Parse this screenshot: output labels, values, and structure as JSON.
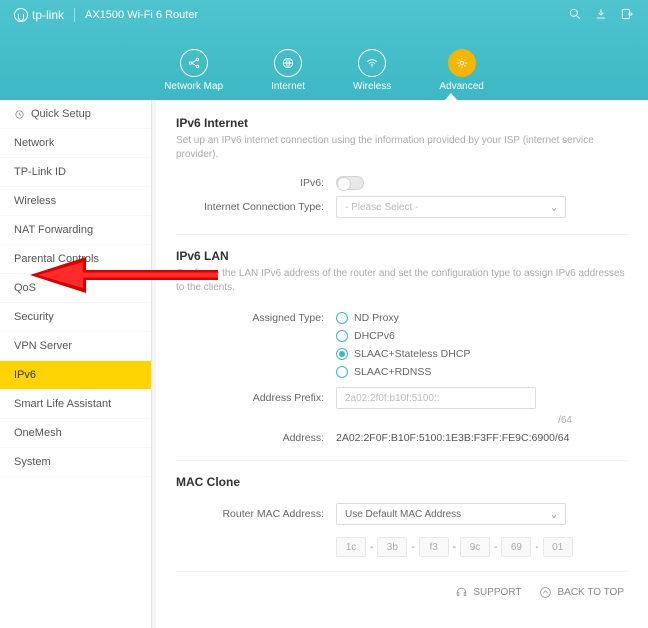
{
  "header": {
    "brand": "tp-link",
    "model": "AX1500 Wi-Fi 6 Router",
    "nav": [
      "Network Map",
      "Internet",
      "Wireless",
      "Advanced"
    ]
  },
  "sidebar": {
    "items": [
      "Quick Setup",
      "Network",
      "TP-Link ID",
      "Wireless",
      "NAT Forwarding",
      "Parental Controls",
      "QoS",
      "Security",
      "VPN Server",
      "IPv6",
      "Smart Life Assistant",
      "OneMesh",
      "System"
    ]
  },
  "ipv6internet": {
    "title": "IPv6 Internet",
    "desc": "Set up an IPv6 internet connection using the information provided by your ISP (internet service provider).",
    "toggle_label": "IPv6:",
    "conn_type_label": "Internet Connection Type:",
    "conn_type_placeholder": "- Please Select -"
  },
  "ipv6lan": {
    "title": "IPv6 LAN",
    "desc": "Configure the LAN IPv6 address of the router and set the configuration type to assign IPv6 addresses to the clients.",
    "assigned_label": "Assigned Type:",
    "options": [
      "ND Proxy",
      "DHCPv6",
      "SLAAC+Stateless DHCP",
      "SLAAC+RDNSS"
    ],
    "prefix_label": "Address Prefix:",
    "prefix_value": "2a02:2f0f:b10f:5100::",
    "prefix_suffix": "/64",
    "address_label": "Address:",
    "address_value": "2A02:2F0F:B10F:5100:1E3B:F3FF:FE9C:6900/64"
  },
  "mac": {
    "title": "MAC Clone",
    "label": "Router MAC Address:",
    "select_value": "Use Default MAC Address",
    "octets": [
      "1c",
      "3b",
      "f3",
      "9c",
      "69",
      "01"
    ]
  },
  "footer": {
    "support": "SUPPORT",
    "backtotop": "BACK TO TOP"
  }
}
